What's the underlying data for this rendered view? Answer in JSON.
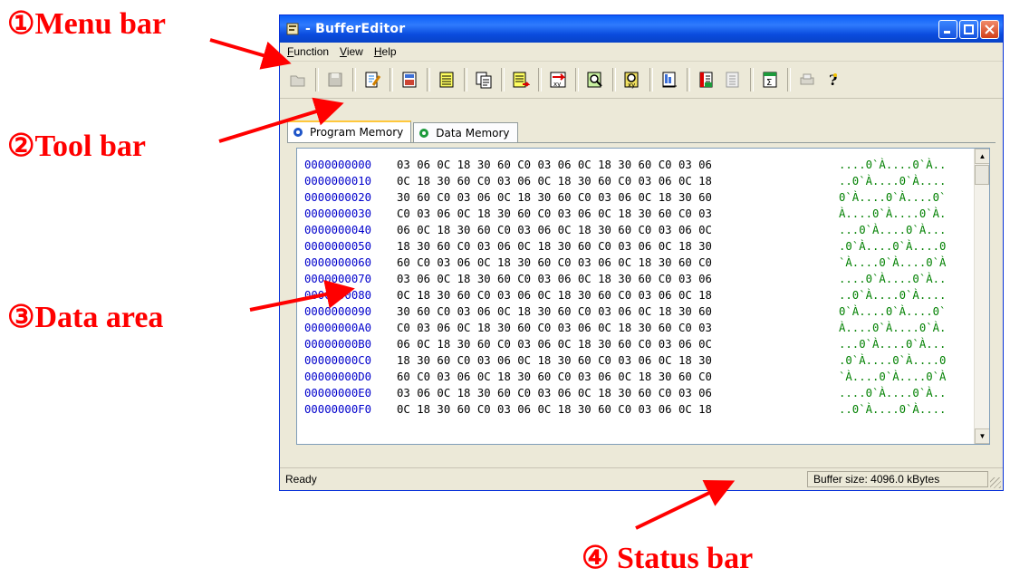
{
  "annotations": {
    "menu_bar": "①Menu bar",
    "tool_bar": "②Tool bar",
    "data_area": "③Data area",
    "status_bar": "④ Status bar"
  },
  "window": {
    "title": "- BufferEditor"
  },
  "menu": [
    "Function",
    "View",
    "Help"
  ],
  "toolbar_icons": [
    "open-icon",
    "save-icon",
    "edit-icon",
    "memory-icon",
    "fill-icon",
    "copy-icon",
    "transfer-icon",
    "swap-icon",
    "search-icon",
    "search-xy-icon",
    "compare-icon",
    "load-icon",
    "export-icon",
    "checksum-icon",
    "print-icon",
    "help-icon"
  ],
  "tabs": [
    {
      "label": "Program Memory",
      "color": "#1f55c8"
    },
    {
      "label": "Data Memory",
      "color": "#1c9a3b"
    }
  ],
  "rows": [
    {
      "addr": "0000000000",
      "hex": "03 06 0C 18 30 60 C0 03 06 0C 18 30 60 C0 03 06",
      "ascii": "....0`À....0`À.."
    },
    {
      "addr": "0000000010",
      "hex": "0C 18 30 60 C0 03 06 0C 18 30 60 C0 03 06 0C 18",
      "ascii": "..0`À....0`À...."
    },
    {
      "addr": "0000000020",
      "hex": "30 60 C0 03 06 0C 18 30 60 C0 03 06 0C 18 30 60",
      "ascii": "0`À....0`À....0`"
    },
    {
      "addr": "0000000030",
      "hex": "C0 03 06 0C 18 30 60 C0 03 06 0C 18 30 60 C0 03",
      "ascii": "À....0`À....0`À."
    },
    {
      "addr": "0000000040",
      "hex": "06 0C 18 30 60 C0 03 06 0C 18 30 60 C0 03 06 0C",
      "ascii": "...0`À....0`À..."
    },
    {
      "addr": "0000000050",
      "hex": "18 30 60 C0 03 06 0C 18 30 60 C0 03 06 0C 18 30",
      "ascii": ".0`À....0`À....0"
    },
    {
      "addr": "0000000060",
      "hex": "60 C0 03 06 0C 18 30 60 C0 03 06 0C 18 30 60 C0",
      "ascii": "`À....0`À....0`À"
    },
    {
      "addr": "0000000070",
      "hex": "03 06 0C 18 30 60 C0 03 06 0C 18 30 60 C0 03 06",
      "ascii": "....0`À....0`À.."
    },
    {
      "addr": "0000000080",
      "hex": "0C 18 30 60 C0 03 06 0C 18 30 60 C0 03 06 0C 18",
      "ascii": "..0`À....0`À...."
    },
    {
      "addr": "0000000090",
      "hex": "30 60 C0 03 06 0C 18 30 60 C0 03 06 0C 18 30 60",
      "ascii": "0`À....0`À....0`"
    },
    {
      "addr": "00000000A0",
      "hex": "C0 03 06 0C 18 30 60 C0 03 06 0C 18 30 60 C0 03",
      "ascii": "À....0`À....0`À."
    },
    {
      "addr": "00000000B0",
      "hex": "06 0C 18 30 60 C0 03 06 0C 18 30 60 C0 03 06 0C",
      "ascii": "...0`À....0`À..."
    },
    {
      "addr": "00000000C0",
      "hex": "18 30 60 C0 03 06 0C 18 30 60 C0 03 06 0C 18 30",
      "ascii": ".0`À....0`À....0"
    },
    {
      "addr": "00000000D0",
      "hex": "60 C0 03 06 0C 18 30 60 C0 03 06 0C 18 30 60 C0",
      "ascii": "`À....0`À....0`À"
    },
    {
      "addr": "00000000E0",
      "hex": "03 06 0C 18 30 60 C0 03 06 0C 18 30 60 C0 03 06",
      "ascii": "....0`À....0`À.."
    },
    {
      "addr": "00000000F0",
      "hex": "0C 18 30 60 C0 03 06 0C 18 30 60 C0 03 06 0C 18",
      "ascii": "..0`À....0`À...."
    }
  ],
  "status": {
    "left": "Ready",
    "right": "Buffer size: 4096.0 kBytes"
  },
  "colors": {
    "annotation": "#ff0000",
    "address": "#0000cc",
    "ascii": "#008000"
  }
}
